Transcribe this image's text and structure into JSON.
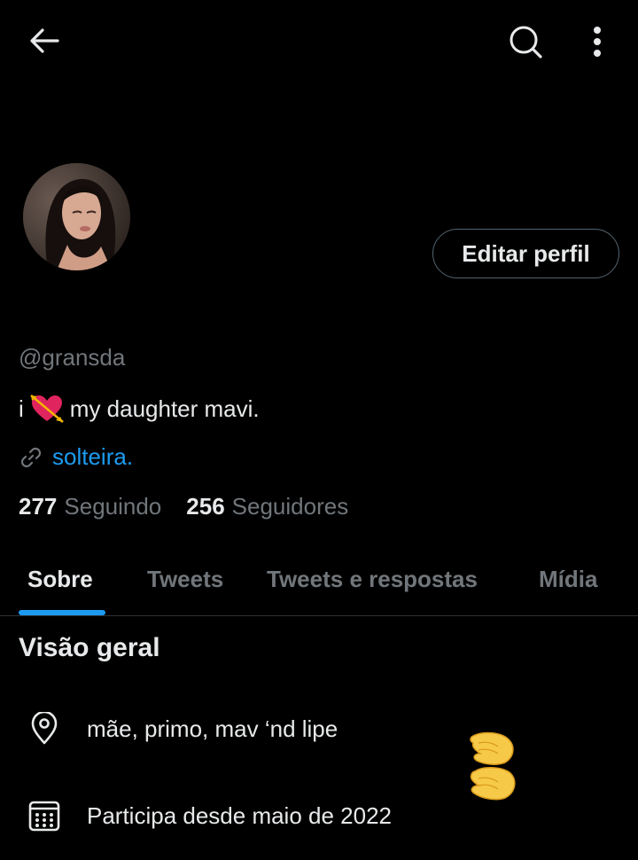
{
  "topbar": {
    "back_icon": "arrow-left-icon",
    "search_icon": "search-icon",
    "more_icon": "more-vertical-icon"
  },
  "profile": {
    "avatar_icon": "profile-photo",
    "edit_button_label": "Editar perfil",
    "handle": "@gransda",
    "bio_prefix": "i",
    "bio_emoji": "heart-with-arrow-emoji",
    "bio_suffix": "my daughter mavi.",
    "link_icon": "link-icon",
    "link_text": "solteira.",
    "following_count": "277",
    "following_label": "Seguindo",
    "followers_count": "256",
    "followers_label": "Seguidores"
  },
  "tabs": [
    {
      "label": "Sobre",
      "active": true
    },
    {
      "label": "Tweets",
      "active": false
    },
    {
      "label": "Tweets e respostas",
      "active": false
    },
    {
      "label": "Mídia",
      "active": false
    }
  ],
  "about": {
    "title": "Visão geral",
    "location_icon": "location-pin-icon",
    "location_text": "mãe, primo, mav ‘nd lipe",
    "joined_icon": "calendar-icon",
    "joined_text": "Participa desde maio de 2022",
    "sticker_emoji": "hands-emoji"
  },
  "colors": {
    "background": "#000000",
    "text_primary": "#e7e9ea",
    "text_secondary": "#71767b",
    "accent": "#1d9bf0",
    "border": "#536471"
  }
}
